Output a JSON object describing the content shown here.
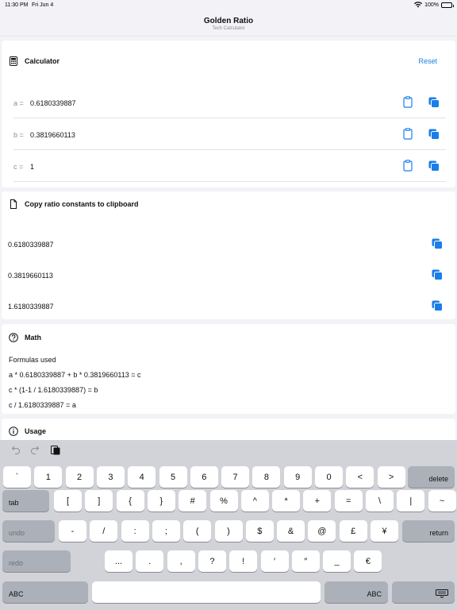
{
  "status": {
    "time": "11:30 PM",
    "date": "Fri Jun 4",
    "battery": "100%"
  },
  "nav": {
    "title": "Golden Ratio",
    "subtitle": "Tech Calculator"
  },
  "calculator": {
    "title": "Calculator",
    "reset": "Reset",
    "rows": [
      {
        "label": "a =",
        "value": "0.6180339887"
      },
      {
        "label": "b =",
        "value": "0.3819660113"
      },
      {
        "label": "c =",
        "value": "1"
      }
    ]
  },
  "constants": {
    "title": "Copy ratio constants to clipboard",
    "values": [
      "0.6180339887",
      "0.3819660113",
      "1.6180339887"
    ]
  },
  "math": {
    "title": "Math",
    "subtitle": "Formulas used",
    "formulas": [
      "a * 0.6180339887 + b * 0.3819660113 = c",
      "c * (1-1 / 1.6180339887) = b",
      "c / 1.6180339887 = a"
    ]
  },
  "usage": {
    "title": "Usage"
  },
  "keyboard": {
    "row1": [
      "`",
      "1",
      "2",
      "3",
      "4",
      "5",
      "6",
      "7",
      "8",
      "9",
      "0",
      "<",
      ">"
    ],
    "delete": "delete",
    "tab": "tab",
    "row2": [
      "[",
      "]",
      "{",
      "}",
      "#",
      "%",
      "^",
      "*",
      "+",
      "=",
      "\\",
      "|",
      "~"
    ],
    "undo": "undo",
    "row3": [
      "-",
      "/",
      ":",
      ";",
      "(",
      ")",
      "$",
      "&",
      "@",
      "£",
      "¥"
    ],
    "return": "return",
    "redo": "redo",
    "row4": [
      "...",
      ".",
      ",",
      "?",
      "!",
      "′",
      "″",
      "_",
      "€"
    ],
    "abc": "ABC"
  },
  "colors": {
    "accent": "#1a7ee8",
    "background": "#f2f2f7",
    "keyboard": "#d1d3d9"
  }
}
